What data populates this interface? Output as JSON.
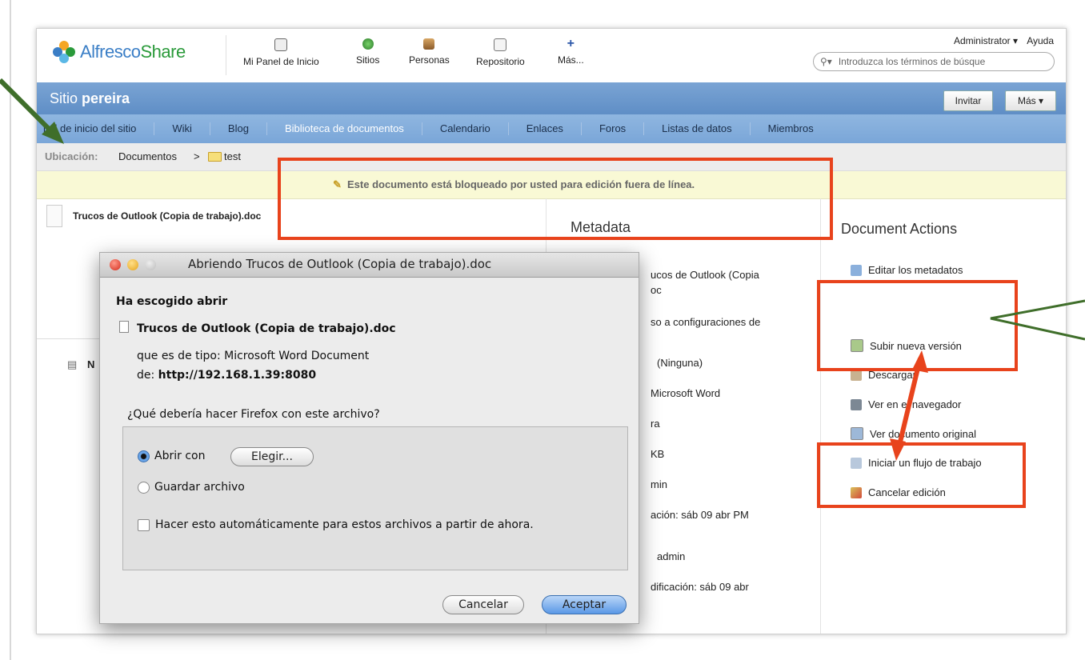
{
  "header": {
    "logo_text_a": "Alfresco",
    "logo_text_b": "Share",
    "nav": [
      {
        "label": "Mi Panel de Inicio",
        "icon": "dashboard-icon"
      },
      {
        "label": "Sitios",
        "icon": "globe-icon"
      },
      {
        "label": "Personas",
        "icon": "people-icon"
      },
      {
        "label": "Repositorio",
        "icon": "repository-icon"
      },
      {
        "label": "Más...",
        "icon": "plus-icon"
      }
    ],
    "user": "Administrator ▾",
    "help": "Ayuda",
    "search_placeholder": "Introduzca los términos de búsque"
  },
  "site": {
    "prefix": "Sitio",
    "name": "pereira",
    "invite_label": "Invitar",
    "more_label": "Más ▾"
  },
  "tabs": [
    {
      "label": "nel de inicio del sitio"
    },
    {
      "label": "Wiki"
    },
    {
      "label": "Blog"
    },
    {
      "label": "Biblioteca de documentos",
      "active": true
    },
    {
      "label": "Calendario"
    },
    {
      "label": "Enlaces"
    },
    {
      "label": "Foros"
    },
    {
      "label": "Listas de datos"
    },
    {
      "label": "Miembros"
    }
  ],
  "location": {
    "label": "Ubicación:",
    "path_root": "Documentos",
    "sep": ">",
    "folder": "test"
  },
  "banner": "Este documento está bloqueado por usted para edición fuera de línea.",
  "document": {
    "title": "Trucos de Outlook (Copia de trabajo).doc",
    "left_fragment": "N"
  },
  "metadata": {
    "title": "Metadata",
    "lines": [
      "ucos de Outlook (Copia",
      "oc",
      "so a configuraciones de",
      "(Ninguna)",
      "Microsoft Word",
      "ra",
      "KB",
      "min",
      "ación:  sáb 09 abr PM",
      "admin",
      "dificación:  sáb 09 abr"
    ]
  },
  "actions": {
    "title": "Document Actions",
    "items": [
      "Editar los metadatos",
      "Subir nueva versión",
      "Descargar",
      "Ver en el navegador",
      "Ver documento original",
      "Iniciar un flujo de trabajo",
      "Cancelar edición"
    ]
  },
  "dialog": {
    "title": "Abriendo Trucos de Outlook (Copia de trabajo).doc",
    "chosen": "Ha escogido abrir",
    "filename": "Trucos de Outlook (Copia de trabajo).doc",
    "type_line": "que es de tipo:  Microsoft Word Document",
    "from_label": "de:",
    "from_url": "http://192.168.1.39:8080",
    "question": "¿Qué debería hacer Firefox con este archivo?",
    "open_with": "Abrir con",
    "choose": "Elegir...",
    "save_file": "Guardar archivo",
    "auto": "Hacer esto automáticamente para estos archivos a partir de ahora.",
    "cancel": "Cancelar",
    "accept": "Aceptar"
  },
  "colors": {
    "annotation_red": "#e8431c",
    "annotation_green": "#3f6e2a",
    "site_blue": "#6f9bcf"
  }
}
